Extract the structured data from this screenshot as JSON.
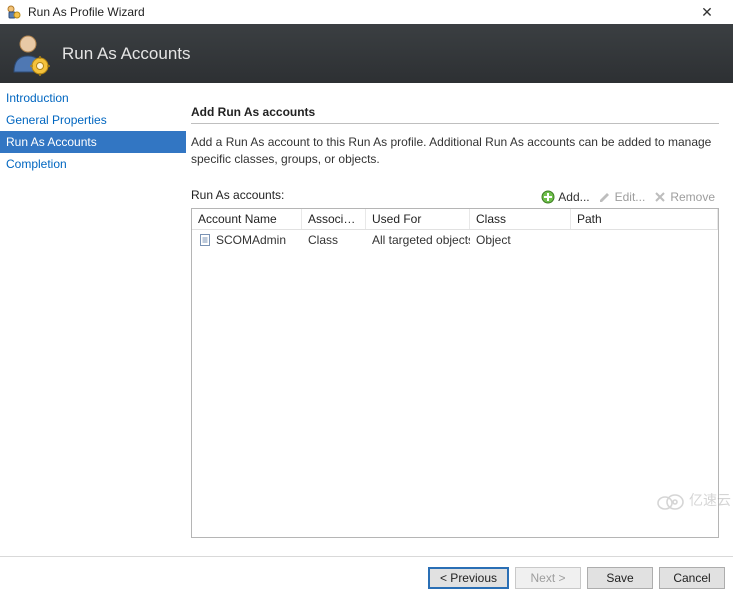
{
  "window": {
    "title": "Run As Profile Wizard"
  },
  "banner": {
    "heading": "Run As Accounts"
  },
  "nav": {
    "items": [
      {
        "label": "Introduction",
        "selected": false
      },
      {
        "label": "General Properties",
        "selected": false
      },
      {
        "label": "Run As Accounts",
        "selected": true
      },
      {
        "label": "Completion",
        "selected": false
      }
    ]
  },
  "main": {
    "heading": "Add Run As accounts",
    "description": "Add a Run As account to this Run As profile.  Additional Run As accounts can be added to manage specific classes, groups, or objects.",
    "list_label": "Run As accounts:",
    "toolbar": {
      "add": "Add...",
      "edit": "Edit...",
      "remove": "Remove"
    },
    "grid": {
      "columns": {
        "name": "Account Name",
        "association": "Association",
        "used_for": "Used For",
        "class": "Class",
        "path": "Path"
      },
      "rows": [
        {
          "name": "SCOMAdmin",
          "association": "Class",
          "used_for": "All targeted objects",
          "class": "Object",
          "path": ""
        }
      ]
    }
  },
  "footer": {
    "previous": "< Previous",
    "next": "Next >",
    "save": "Save",
    "cancel": "Cancel"
  },
  "watermark": {
    "text": "亿速云"
  }
}
